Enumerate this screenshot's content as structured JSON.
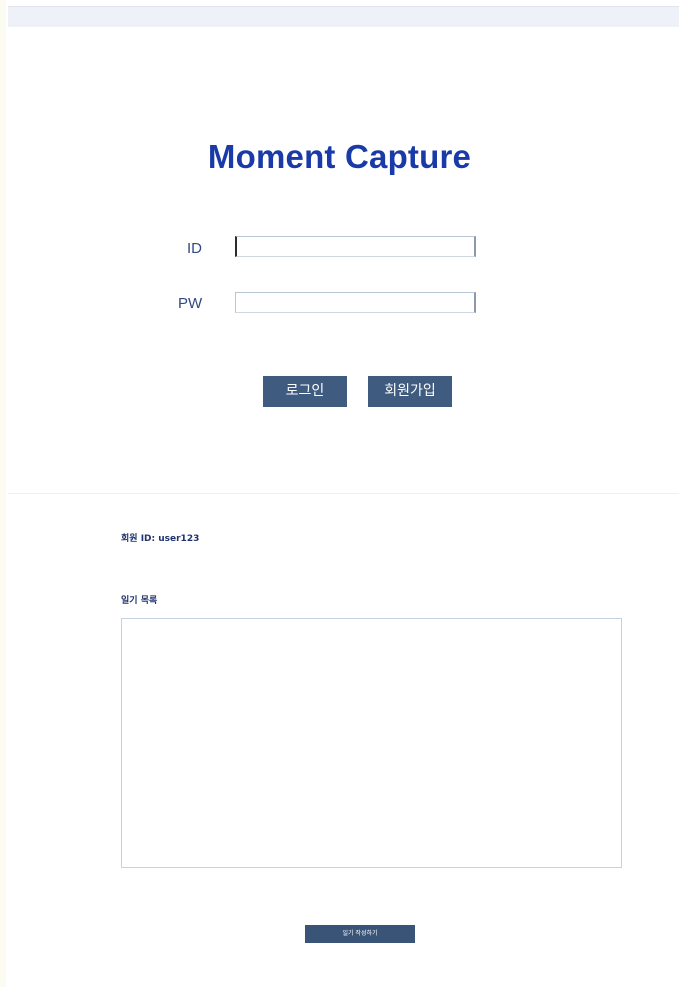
{
  "app": {
    "title": "Moment Capture"
  },
  "login_form": {
    "id_label": "ID",
    "id_value": "",
    "pw_label": "PW",
    "pw_value": "",
    "login_button": "로그인",
    "signup_button": "회원가입"
  },
  "member": {
    "id_text": "회원 ID: user123"
  },
  "diary": {
    "heading": "일기 목록",
    "entries": [],
    "write_button": "일기 작성하기"
  },
  "colors": {
    "title": "#1a3aa8",
    "button_bg": "#3f5b7f",
    "label_text": "#2f4a80"
  }
}
